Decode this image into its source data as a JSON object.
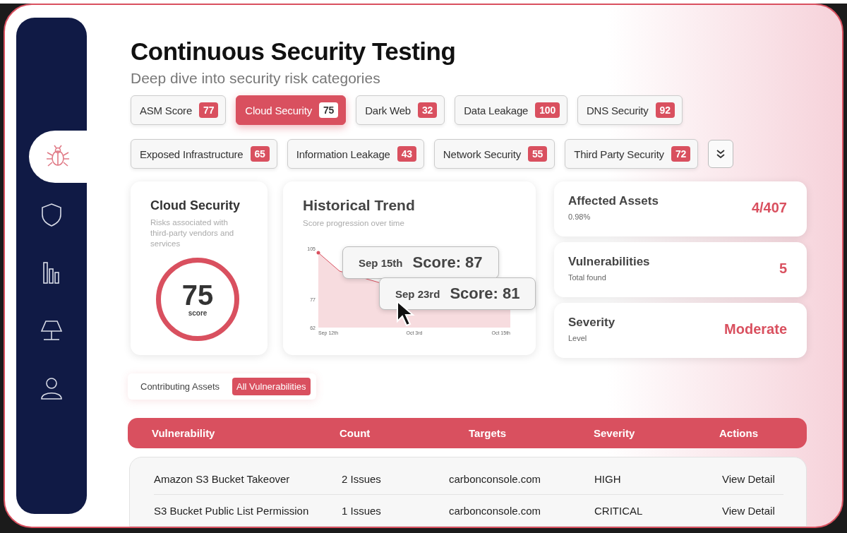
{
  "sidebar": {
    "items": [
      {
        "kind": "bug",
        "selected": true
      },
      {
        "kind": "shield",
        "selected": false
      },
      {
        "kind": "bars",
        "selected": false
      },
      {
        "kind": "lamp",
        "selected": false
      },
      {
        "kind": "user",
        "selected": false
      }
    ]
  },
  "title": "Continuous Security Testing",
  "subtitle": "Deep dive into security risk categories",
  "categories": [
    [
      {
        "label": "ASM Score",
        "count": "77",
        "selected": false
      },
      {
        "label": "Cloud Security",
        "count": "75",
        "selected": true
      },
      {
        "label": "Dark Web",
        "count": "32",
        "selected": false
      },
      {
        "label": "Data Leakage",
        "count": "100",
        "selected": false
      },
      {
        "label": "DNS Security",
        "count": "92",
        "selected": false
      }
    ],
    [
      {
        "label": "Exposed Infrastructure",
        "count": "65",
        "selected": false
      },
      {
        "label": "Information Leakage",
        "count": "43",
        "selected": false
      },
      {
        "label": "Network Security",
        "count": "55",
        "selected": false
      },
      {
        "label": "Third Party Security",
        "count": "72",
        "selected": false
      }
    ]
  ],
  "score_card": {
    "title": "Cloud Security",
    "description": "Risks associated with third-party vendors and services",
    "score": "75",
    "score_label": "score"
  },
  "trend": {
    "title": "Historical Trend",
    "subtitle": "Score progression over time",
    "y_ticks": [
      "105",
      "77",
      "62"
    ],
    "x_ticks": [
      "Sep 12th",
      "Oct 3rd",
      "Oct 15th"
    ],
    "tooltips": [
      {
        "date": "Sep 15th",
        "score": "Score: 87"
      },
      {
        "date": "Sep 23rd",
        "score": "Score: 81"
      }
    ]
  },
  "stats": [
    {
      "label": "Affected Assets",
      "sub": "0.98%",
      "value": "4/407"
    },
    {
      "label": "Vulnerabilities",
      "sub": "Total found",
      "value": "5"
    },
    {
      "label": "Severity",
      "sub": "Level",
      "value": "Moderate"
    }
  ],
  "view_tabs": [
    {
      "label": "Contributing Assets",
      "selected": false
    },
    {
      "label": "All Vulnerabilities",
      "selected": true
    }
  ],
  "table": {
    "columns": [
      "Vulnerability",
      "Count",
      "Targets",
      "Severity",
      "Actions"
    ],
    "rows": [
      [
        "Amazon S3 Bucket Takeover",
        "2 Issues",
        "carbonconsole.com",
        "HIGH",
        "View Detail"
      ],
      [
        "S3 Bucket Public List Permission",
        "1 Issues",
        "carbonconsole.com",
        "CRITICAL",
        "View Detail"
      ]
    ]
  }
}
